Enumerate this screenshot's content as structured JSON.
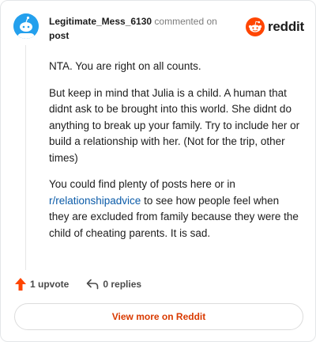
{
  "comment": {
    "author": "Legitimate_Mess_6130",
    "action_text": "commented on",
    "post_link": "post",
    "paragraphs": [
      "NTA. You are right on all counts.",
      "But keep in mind that Julia is a child. A human that didnt ask to be brought into this world. She didnt do anything to break up your family. Try to include her or build a relationship with her. (Not for the trip, other times)"
    ],
    "third_paragraph": {
      "before": "You could find plenty of posts here or in ",
      "link": "r/relationshipadvice",
      "after": " to see how people feel when they are excluded from family because they were the child of cheating parents. It is sad."
    }
  },
  "brand": {
    "wordmark": "reddit",
    "icon": "reddit-logo-icon"
  },
  "actions": {
    "upvote_label": "1 upvote",
    "upvote_icon": "upvote-arrow-icon",
    "replies_label": "0 replies",
    "reply_icon": "reply-arrow-icon"
  },
  "footer": {
    "view_more_label": "View more on Reddit"
  },
  "colors": {
    "accent_orange": "#ff4500",
    "link_blue": "#0b5ba8",
    "avatar_blue": "#24a0ed",
    "button_text": "#d93a00"
  }
}
